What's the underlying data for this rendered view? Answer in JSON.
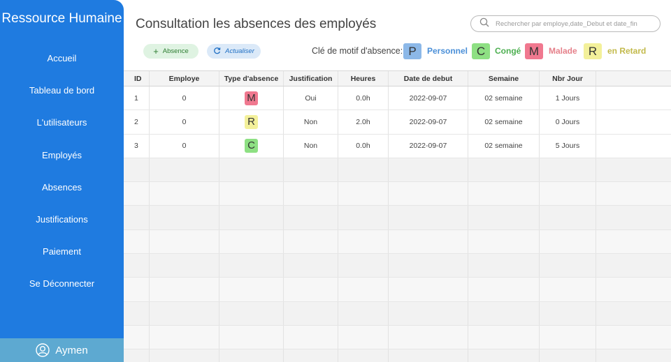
{
  "app": {
    "title": "Ressource Humaine"
  },
  "sidebar": {
    "items": [
      {
        "label": "Accueil"
      },
      {
        "label": "Tableau de bord"
      },
      {
        "label": "L'utilisateurs"
      },
      {
        "label": "Employés"
      },
      {
        "label": "Absences"
      },
      {
        "label": "Justifications"
      },
      {
        "label": "Paiement"
      },
      {
        "label": "Se Déconnecter"
      }
    ],
    "user": {
      "name": "Aymen",
      "icon": "user-circle-icon"
    }
  },
  "header": {
    "title": "Consultation les absences des employés",
    "search_placeholder": "Rechercher par employe,date_Debut et date_fin"
  },
  "toolbar": {
    "add_label": "Absence",
    "refresh_label": "Actualiser"
  },
  "legend": {
    "label": "Clé de motif d'absence:",
    "items": [
      {
        "code": "P",
        "name": "Personnel",
        "color": "#8cb8e8",
        "text_color": "#4a8fd8"
      },
      {
        "code": "C",
        "name": "Congé",
        "color": "#8ee083",
        "text_color": "#4caf50"
      },
      {
        "code": "M",
        "name": "Malade",
        "color": "#f0788f",
        "text_color": "#e5808a"
      },
      {
        "code": "R",
        "name": "en Retard",
        "color": "#f3f09a",
        "text_color": "#c2b94a"
      }
    ]
  },
  "table": {
    "columns": [
      "ID",
      "Employe",
      "Type d'absence",
      "Justification",
      "Heures",
      "Date de debut",
      "Semaine",
      "Nbr Jour"
    ],
    "rows": [
      {
        "id": "1",
        "employe": "0",
        "type": "M",
        "type_color": "#f0788f",
        "justification": "Oui",
        "heures": "0.0h",
        "date": "2022-09-07",
        "semaine": "02 semaine",
        "nbr": "1 Jours"
      },
      {
        "id": "2",
        "employe": "0",
        "type": "R",
        "type_color": "#f3f09a",
        "justification": "Non",
        "heures": "2.0h",
        "date": "2022-09-07",
        "semaine": "02 semaine",
        "nbr": "0 Jours"
      },
      {
        "id": "3",
        "employe": "0",
        "type": "C",
        "type_color": "#8ee083",
        "justification": "Non",
        "heures": "0.0h",
        "date": "2022-09-07",
        "semaine": "02 semaine",
        "nbr": "5 Jours"
      }
    ]
  }
}
